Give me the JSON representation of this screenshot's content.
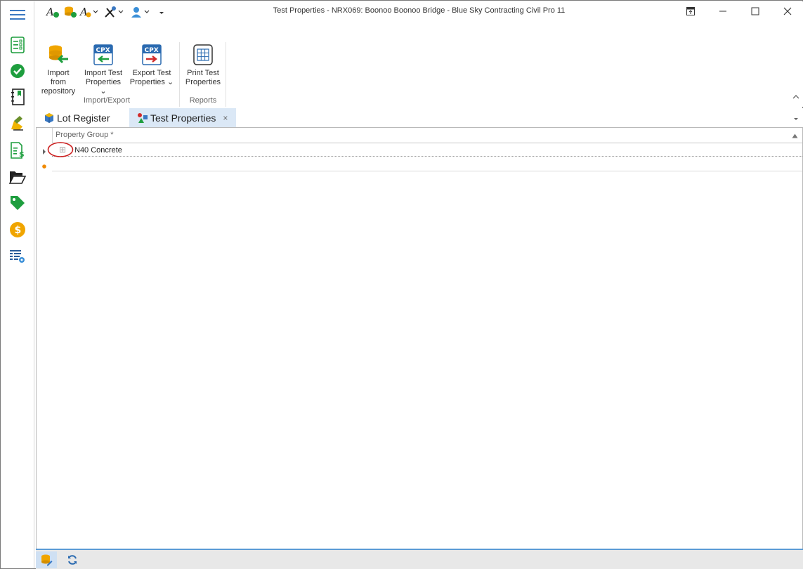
{
  "window": {
    "title": "Test Properties - NRX069: Boonoo Boonoo Bridge  - Blue Sky Contracting Civil Pro 11"
  },
  "quick_access": [
    "formula-icon",
    "database-refresh-icon",
    "formula-dropdown-icon",
    "tools-icon",
    "user-icon",
    "customize-icon"
  ],
  "ribbon": {
    "groups": [
      {
        "label": "Import/Export",
        "buttons": [
          {
            "line1": "Import from",
            "line2": "repository",
            "icon": "database-import-icon"
          },
          {
            "line1": "Import Test",
            "line2": "Properties",
            "icon": "cpx-import-icon",
            "dropdown": true
          },
          {
            "line1": "Export Test",
            "line2": "Properties",
            "icon": "cpx-export-icon",
            "dropdown": true
          }
        ]
      },
      {
        "label": "Reports",
        "buttons": [
          {
            "line1": "Print Test",
            "line2": "Properties",
            "icon": "print-table-icon"
          }
        ]
      }
    ]
  },
  "tabs": [
    {
      "label": "Lot Register",
      "active": false
    },
    {
      "label": "Test Properties",
      "active": true,
      "close": "×"
    }
  ],
  "grid": {
    "column_header": "Property Group *",
    "rows": [
      {
        "label": "N40 Concrete",
        "expand": "⊞"
      }
    ]
  },
  "rail": [
    "menu-icon",
    "checklist-icon",
    "approved-icon",
    "notebook-icon",
    "edit-hand-icon",
    "invoice-icon",
    "folder-open-icon",
    "tag-icon",
    "dollar-coin-icon",
    "table-settings-icon"
  ],
  "colors": {
    "accent": "#5b9bd5",
    "green": "#1e9e3e",
    "coin": "#f0a500",
    "tab_active": "#dbe8f6",
    "highlight_circle": "#cc1f1f"
  }
}
